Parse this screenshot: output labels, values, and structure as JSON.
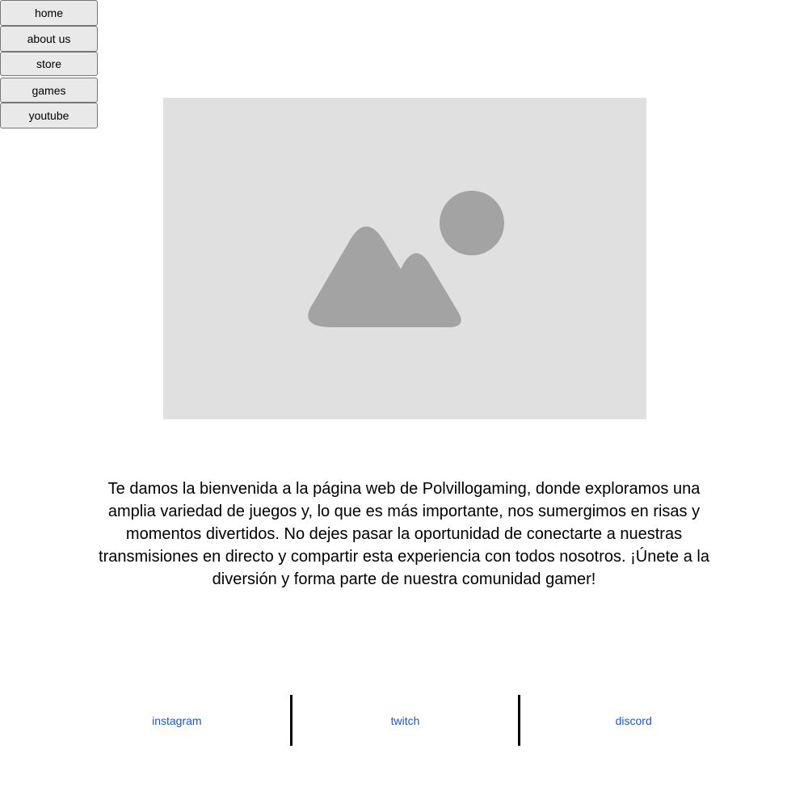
{
  "nav": {
    "items": [
      {
        "label": "home"
      },
      {
        "label": "about us"
      },
      {
        "label": "store"
      },
      {
        "label": "games"
      },
      {
        "label": "youtube"
      }
    ]
  },
  "hero": {
    "icon": "image-placeholder-icon"
  },
  "intro": {
    "text": "Te damos la bienvenida a la página web de Polvillogaming, donde exploramos una amplia variedad de juegos y, lo que es más importante, nos sumergimos en risas y momentos divertidos. No dejes pasar la oportunidad de conectarte a nuestras transmisiones en directo y compartir esta experiencia con todos nosotros. ¡Únete a la diversión y forma parte de nuestra comunidad gamer!"
  },
  "social": {
    "links": [
      {
        "label": "instagram"
      },
      {
        "label": "twitch"
      },
      {
        "label": "discord"
      }
    ]
  },
  "colors": {
    "link": "#1a55d9",
    "placeholder_bg": "#e0e0e0",
    "placeholder_icon": "#a3a3a3",
    "button_bg": "#e9e9e9"
  }
}
